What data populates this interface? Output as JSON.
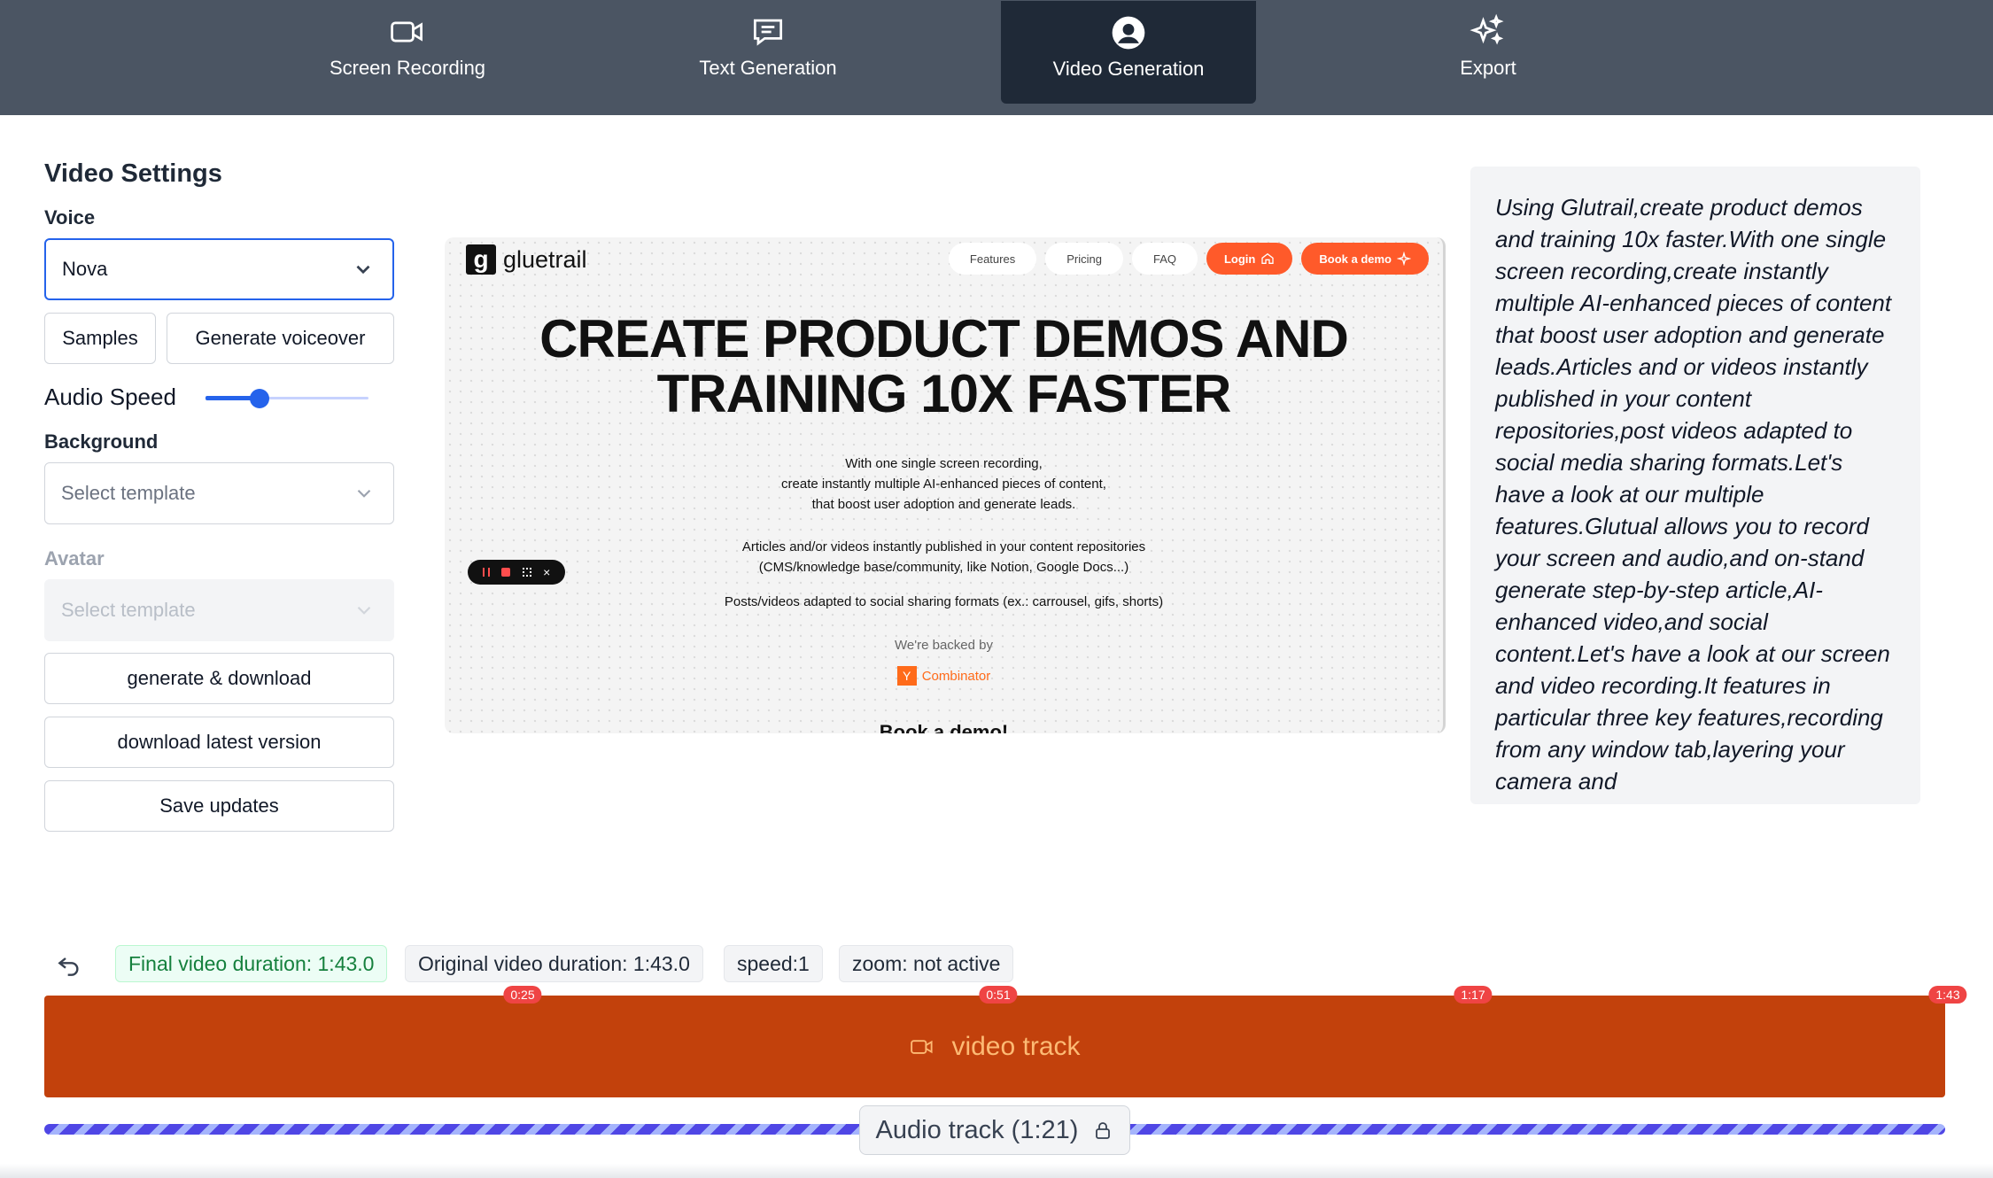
{
  "tabs": [
    {
      "label": "Screen Recording",
      "icon": "video-camera-icon"
    },
    {
      "label": "Text Generation",
      "icon": "chat-bubble-icon"
    },
    {
      "label": "Video Generation",
      "icon": "user-circle-icon",
      "active": true
    },
    {
      "label": "Export",
      "icon": "sparkles-icon"
    }
  ],
  "settings": {
    "title": "Video Settings",
    "voice_label": "Voice",
    "voice_value": "Nova",
    "samples_label": "Samples",
    "generate_voiceover_label": "Generate voiceover",
    "audio_speed_label": "Audio Speed",
    "audio_speed_level": 0.33,
    "background_label": "Background",
    "background_placeholder": "Select template",
    "avatar_label": "Avatar",
    "avatar_placeholder": "Select template",
    "generate_download_label": "generate & download",
    "download_latest_label": "download latest version",
    "save_updates_label": "Save updates"
  },
  "preview": {
    "logo_mark": "g",
    "logo_word": "gluetrail",
    "nav": [
      "Features",
      "Pricing",
      "FAQ"
    ],
    "login_label": "Login",
    "book_demo_label": "Book a demo",
    "headline_line1": "CREATE PRODUCT DEMOS AND",
    "headline_line2": "TRAINING 10X FASTER",
    "para1_l1": "With one single screen recording,",
    "para1_l2": "create instantly multiple AI-enhanced pieces of content,",
    "para1_l3": "that boost user adoption and generate leads.",
    "para2_l1": "Articles and/or videos instantly published in your content repositories",
    "para2_l2": "(CMS/knowledge base/community, like Notion, Google Docs...)",
    "para3": "Posts/videos adapted to social sharing formats (ex.: carrousel, gifs, shorts)",
    "backed_by": "We're backed by",
    "yc_letter": "Y",
    "yc_word": "Combinator",
    "cutoff_text": "Book a demo!"
  },
  "transcript": "Using Glutrail,create product demos and training 10x faster.With one single screen recording,create instantly multiple AI-enhanced pieces of content that boost user adoption and generate leads.Articles and or videos instantly published in your content repositories,post videos adapted to social media sharing formats.Let's have a look at our multiple features.Glutual allows you to record your screen and audio,and on-stand generate step-by-step article,AI-enhanced video,and social content.Let's have a look at our screen and video recording.It features in particular three key features,recording from any window tab,layering your camera and",
  "timeline": {
    "final_duration": "Final video duration: 1:43.0",
    "original_duration": "Original video duration: 1:43.0",
    "speed": "speed:1",
    "zoom": "zoom: not active",
    "markers": [
      "0:25",
      "0:51",
      "1:17",
      "1:43"
    ],
    "video_track_label": "video track",
    "audio_track_label": "Audio track (1:21)"
  },
  "colors": {
    "nav_bg": "#4b5563",
    "nav_active": "#1f2937",
    "video_track": "#c2410c",
    "accent_blue": "#2563eb",
    "brand_orange": "#ff5a2a"
  }
}
